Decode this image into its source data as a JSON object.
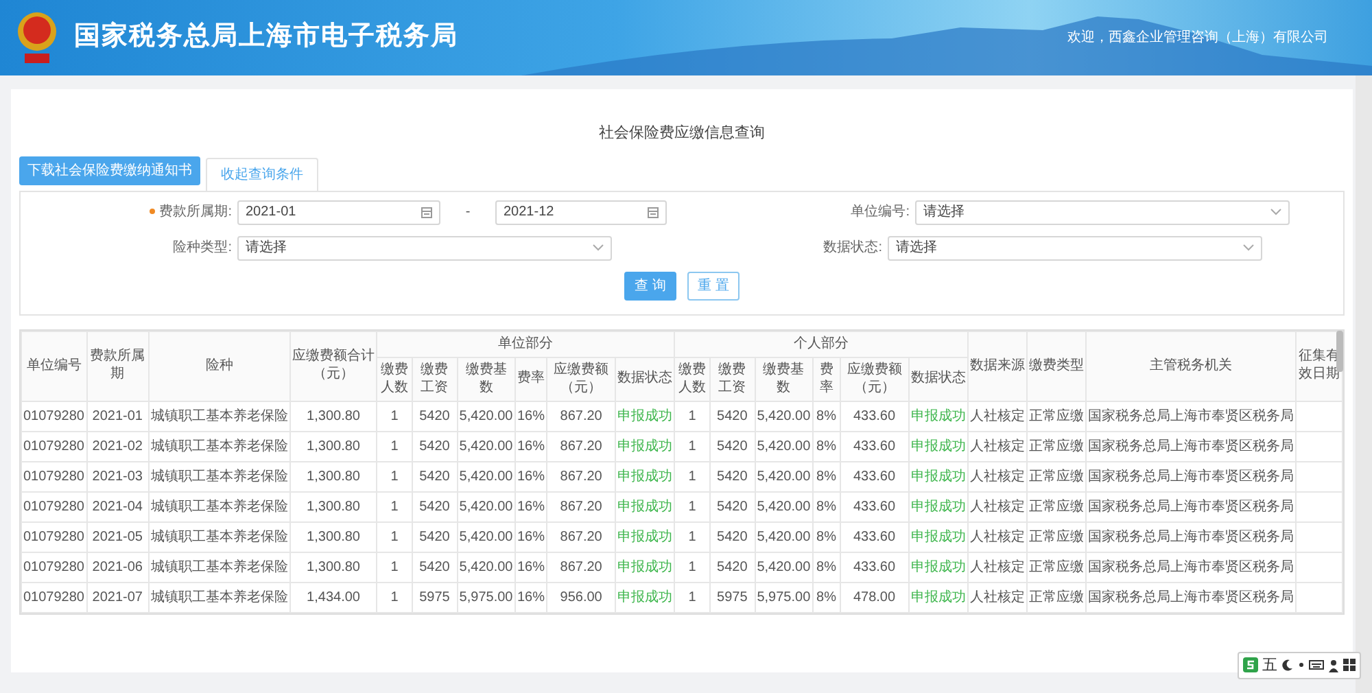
{
  "header": {
    "title": "国家税务总局上海市电子税务局",
    "welcome": "欢迎，西鑫企业管理咨询（上海）有限公司"
  },
  "page_title": "社会保险费应缴信息查询",
  "download_button": "下载社会保险费缴纳通知书",
  "tabs": [
    {
      "label": "收起查询条件",
      "selected": true
    }
  ],
  "form": {
    "rows": [
      {
        "left": {
          "label": "费款所属期:",
          "required": true,
          "kind": "month-range",
          "from": "2021-01",
          "separator": "-",
          "to": "2021-12"
        },
        "right": {
          "label": "单位编号:",
          "required": false,
          "kind": "select",
          "placeholder": "请选择"
        }
      },
      {
        "left": {
          "label": "险种类型:",
          "required": false,
          "kind": "select",
          "placeholder": "请选择"
        },
        "right": {
          "label": "数据状态:",
          "required": false,
          "kind": "select",
          "placeholder": "请选择"
        }
      }
    ],
    "buttons": [
      {
        "label": "查 询",
        "kind": "primary"
      },
      {
        "label": "重 置",
        "kind": "outline"
      }
    ]
  },
  "table": {
    "columns_before": [
      {
        "label": "单位编号"
      },
      {
        "label": "费款所属期"
      },
      {
        "label": "险种"
      },
      {
        "label": "应缴费额合计（元）"
      }
    ],
    "groups": [
      {
        "title": "单位部分",
        "columns": [
          {
            "label": "缴费人数",
            "kind": "text"
          },
          {
            "label": "缴费工资",
            "kind": "text"
          },
          {
            "label": "缴费基数",
            "kind": "text"
          },
          {
            "label": "费率",
            "kind": "text"
          },
          {
            "label": "应缴费额（元）",
            "kind": "text"
          },
          {
            "label": "数据状态",
            "kind": "status"
          }
        ]
      },
      {
        "title": "个人部分",
        "columns": [
          {
            "label": "缴费人数",
            "kind": "text"
          },
          {
            "label": "缴费工资",
            "kind": "text"
          },
          {
            "label": "缴费基数",
            "kind": "text"
          },
          {
            "label": "费率",
            "kind": "text"
          },
          {
            "label": "应缴费额（元）",
            "kind": "text"
          },
          {
            "label": "数据状态",
            "kind": "status"
          }
        ]
      }
    ],
    "columns_after": [
      {
        "label": "数据来源"
      },
      {
        "label": "缴费类型"
      },
      {
        "label": "主管税务机关"
      },
      {
        "label": "征集有效日期"
      }
    ],
    "rows": [
      [
        "01079280",
        "2021-01",
        "城镇职工基本养老保险",
        "1,300.80",
        "1",
        "5420",
        "5,420.00",
        "16%",
        "867.20",
        "申报成功",
        "1",
        "5420",
        "5,420.00",
        "8%",
        "433.60",
        "申报成功",
        "人社核定",
        "正常应缴",
        "国家税务总局上海市奉贤区税务局"
      ],
      [
        "01079280",
        "2021-02",
        "城镇职工基本养老保险",
        "1,300.80",
        "1",
        "5420",
        "5,420.00",
        "16%",
        "867.20",
        "申报成功",
        "1",
        "5420",
        "5,420.00",
        "8%",
        "433.60",
        "申报成功",
        "人社核定",
        "正常应缴",
        "国家税务总局上海市奉贤区税务局"
      ],
      [
        "01079280",
        "2021-03",
        "城镇职工基本养老保险",
        "1,300.80",
        "1",
        "5420",
        "5,420.00",
        "16%",
        "867.20",
        "申报成功",
        "1",
        "5420",
        "5,420.00",
        "8%",
        "433.60",
        "申报成功",
        "人社核定",
        "正常应缴",
        "国家税务总局上海市奉贤区税务局"
      ],
      [
        "01079280",
        "2021-04",
        "城镇职工基本养老保险",
        "1,300.80",
        "1",
        "5420",
        "5,420.00",
        "16%",
        "867.20",
        "申报成功",
        "1",
        "5420",
        "5,420.00",
        "8%",
        "433.60",
        "申报成功",
        "人社核定",
        "正常应缴",
        "国家税务总局上海市奉贤区税务局"
      ],
      [
        "01079280",
        "2021-05",
        "城镇职工基本养老保险",
        "1,300.80",
        "1",
        "5420",
        "5,420.00",
        "16%",
        "867.20",
        "申报成功",
        "1",
        "5420",
        "5,420.00",
        "8%",
        "433.60",
        "申报成功",
        "人社核定",
        "正常应缴",
        "国家税务总局上海市奉贤区税务局"
      ],
      [
        "01079280",
        "2021-06",
        "城镇职工基本养老保险",
        "1,300.80",
        "1",
        "5420",
        "5,420.00",
        "16%",
        "867.20",
        "申报成功",
        "1",
        "5420",
        "5,420.00",
        "8%",
        "433.60",
        "申报成功",
        "人社核定",
        "正常应缴",
        "国家税务总局上海市奉贤区税务局"
      ],
      [
        "01079280",
        "2021-07",
        "城镇职工基本养老保险",
        "1,434.00",
        "1",
        "5975",
        "5,975.00",
        "16%",
        "956.00",
        "申报成功",
        "1",
        "5975",
        "5,975.00",
        "8%",
        "478.00",
        "申报成功",
        "人社核定",
        "正常应缴",
        "国家税务总局上海市奉贤区税务局"
      ]
    ]
  },
  "ime_toolbar": {
    "mode": "五"
  }
}
